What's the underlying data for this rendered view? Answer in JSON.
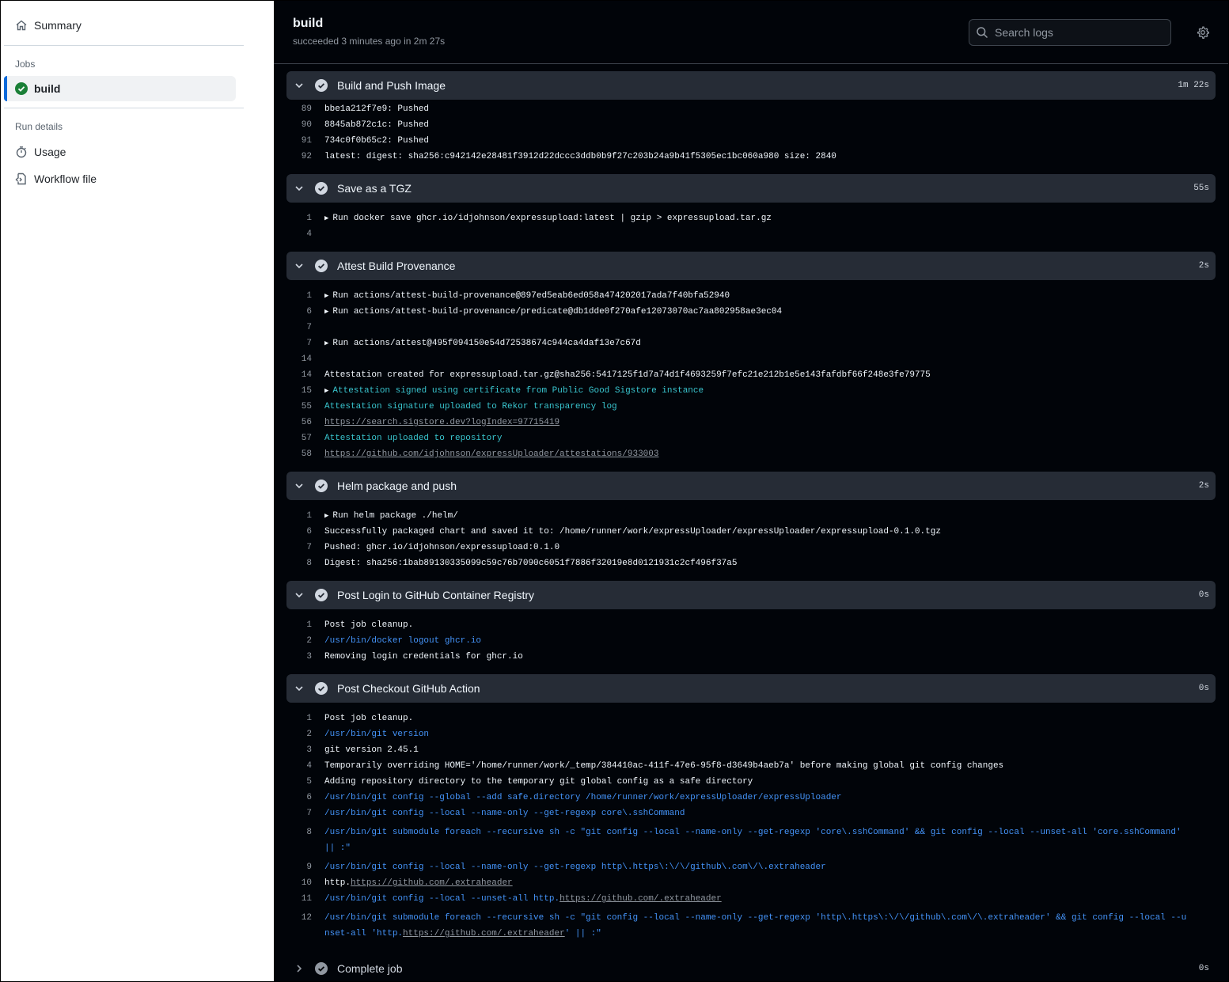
{
  "sidebar": {
    "summary_label": "Summary",
    "jobs_heading": "Jobs",
    "job_label": "build",
    "run_details_heading": "Run details",
    "usage_label": "Usage",
    "workflow_file_label": "Workflow file"
  },
  "header": {
    "title": "build",
    "subtitle": "succeeded 3 minutes ago in 2m 27s",
    "search_placeholder": "Search logs"
  },
  "steps": [
    {
      "name": "Build and Push Image",
      "duration": "1m 22s",
      "lines": [
        {
          "n": "89",
          "t": "bbe1a212f7e9: Pushed"
        },
        {
          "n": "90",
          "t": "8845ab872c1c: Pushed"
        },
        {
          "n": "91",
          "t": "734c0f0b65c2: Pushed"
        },
        {
          "n": "92",
          "t": "latest: digest: sha256:c942142e28481f3912d22dccc3ddb0b9f27c203b24a9b41f5305ec1bc060a980 size: 2840"
        }
      ]
    },
    {
      "name": "Save as a TGZ",
      "duration": "55s",
      "lines": [
        {
          "n": "1",
          "t": "Run docker save ghcr.io/idjohnson/expressupload:latest | gzip > expressupload.tar.gz"
        },
        {
          "n": "4",
          "t": ""
        }
      ]
    },
    {
      "name": "Attest Build Provenance",
      "duration": "2s",
      "lines": [
        {
          "n": "1",
          "t": "Run actions/attest-build-provenance@897ed5eab6ed058a474202017ada7f40bfa52940"
        },
        {
          "n": "6",
          "t": "Run actions/attest-build-provenance/predicate@db1dde0f270afe12073070ac7aa802958ae3ec04"
        },
        {
          "n": "7",
          "t": ""
        },
        {
          "n": "7",
          "t": "Run actions/attest@495f094150e54d72538674c944ca4daf13e7c67d"
        },
        {
          "n": "14",
          "t": ""
        },
        {
          "n": "14",
          "t": "Attestation created for expressupload.tar.gz@sha256:5417125f1d7a74d1f4693259f7efc21e212b1e5e143fafdbf66f248e3fe79775"
        },
        {
          "n": "15",
          "t": "Attestation signed using certificate from Public Good Sigstore instance"
        },
        {
          "n": "55",
          "t": "Attestation signature uploaded to Rekor transparency log"
        },
        {
          "n": "56",
          "t": "https://search.sigstore.dev?logIndex=97715419"
        },
        {
          "n": "57",
          "t": "Attestation uploaded to repository"
        },
        {
          "n": "58",
          "t": "https://github.com/idjohnson/expressUploader/attestations/933003"
        }
      ]
    },
    {
      "name": "Helm package and push",
      "duration": "2s",
      "lines": [
        {
          "n": "1",
          "t": "Run helm package ./helm/"
        },
        {
          "n": "6",
          "t": "Successfully packaged chart and saved it to: /home/runner/work/expressUploader/expressUploader/expressupload-0.1.0.tgz"
        },
        {
          "n": "7",
          "t": "Pushed: ghcr.io/idjohnson/expressupload:0.1.0"
        },
        {
          "n": "8",
          "t": "Digest: sha256:1bab89130335099c59c76b7090c6051f7886f32019e8d0121931c2cf496f37a5"
        }
      ]
    },
    {
      "name": "Post Login to GitHub Container Registry",
      "duration": "0s",
      "lines": [
        {
          "n": "1",
          "t": "Post job cleanup."
        },
        {
          "n": "2",
          "t": "/usr/bin/docker logout ghcr.io"
        },
        {
          "n": "3",
          "t": "Removing login credentials for ghcr.io"
        }
      ]
    },
    {
      "name": "Post Checkout GitHub Action",
      "duration": "0s",
      "lines": [
        {
          "n": "1",
          "t": "Post job cleanup."
        },
        {
          "n": "2",
          "t": "/usr/bin/git version"
        },
        {
          "n": "3",
          "t": "git version 2.45.1"
        },
        {
          "n": "4",
          "t": "Temporarily overriding HOME='/home/runner/work/_temp/384410ac-411f-47e6-95f8-d3649b4aeb7a' before making global git config changes"
        },
        {
          "n": "5",
          "t": "Adding repository directory to the temporary git global config as a safe directory"
        },
        {
          "n": "6",
          "t": "/usr/bin/git config --global --add safe.directory /home/runner/work/expressUploader/expressUploader"
        },
        {
          "n": "7",
          "t": "/usr/bin/git config --local --name-only --get-regexp core\\.sshCommand"
        },
        {
          "n": "8",
          "t": "/usr/bin/git submodule foreach --recursive sh -c \"git config --local --name-only --get-regexp 'core\\.sshCommand' && git config --local --unset-all 'core.sshCommand' || :\""
        },
        {
          "n": "9",
          "t": "/usr/bin/git config --local --name-only --get-regexp http\\.https\\:\\/\\/github\\.com\\/\\.extraheader"
        },
        {
          "n": "10",
          "t_prefix": "http.",
          "t_link": "https://github.com/.extraheader"
        },
        {
          "n": "11",
          "t_prefix": "/usr/bin/git config --local --unset-all http.",
          "t_link": "https://github.com/.extraheader"
        },
        {
          "n": "12",
          "t_prefix": "/usr/bin/git submodule foreach --recursive sh -c \"git config --local --name-only --get-regexp 'http\\.https\\:\\/\\/github\\.com\\/\\.extraheader' && git config --local --unset-all 'http.",
          "t_link": "https://github.com/.extraheader",
          "t_suffix": "' || :\""
        }
      ]
    },
    {
      "name": "Complete job",
      "duration": "0s"
    }
  ],
  "colors": {
    "success": "#1a7f37",
    "accent": "#0969da",
    "log_bg": "#010409",
    "step_bg": "#262c36",
    "command_text": "#4493f8",
    "attestation_text": "#39c5cf"
  },
  "icons": {
    "summary": "home-icon",
    "usage": "stopwatch-icon",
    "workflow_file": "file-code-icon",
    "search": "search-icon",
    "settings": "gear-icon",
    "step_expanded": "chevron-down-icon",
    "step_collapsed": "chevron-right-icon",
    "step_status": "check-circle-icon",
    "job_status": "check-circle-fill-icon"
  }
}
